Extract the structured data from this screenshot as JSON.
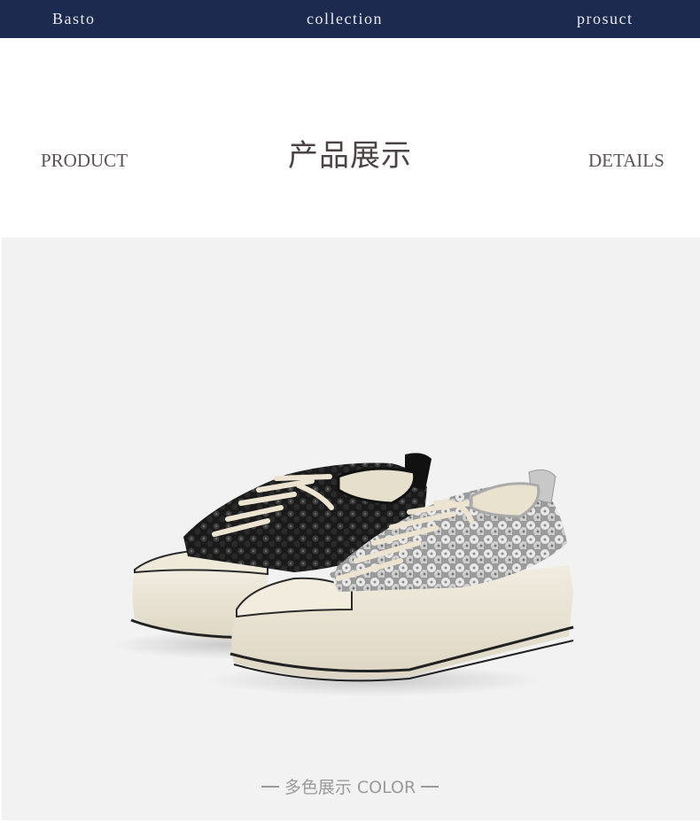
{
  "nav": {
    "items": [
      "Basto",
      "collection",
      "prosuct"
    ]
  },
  "heading": {
    "left": "PRODUCT",
    "center": "产品展示",
    "right": "DETAILS"
  },
  "caption": {
    "text": "多色展示 COLOR"
  },
  "colors": {
    "nav_bg": "#1b2a4e",
    "photo_bg": "#f2f2f2"
  }
}
